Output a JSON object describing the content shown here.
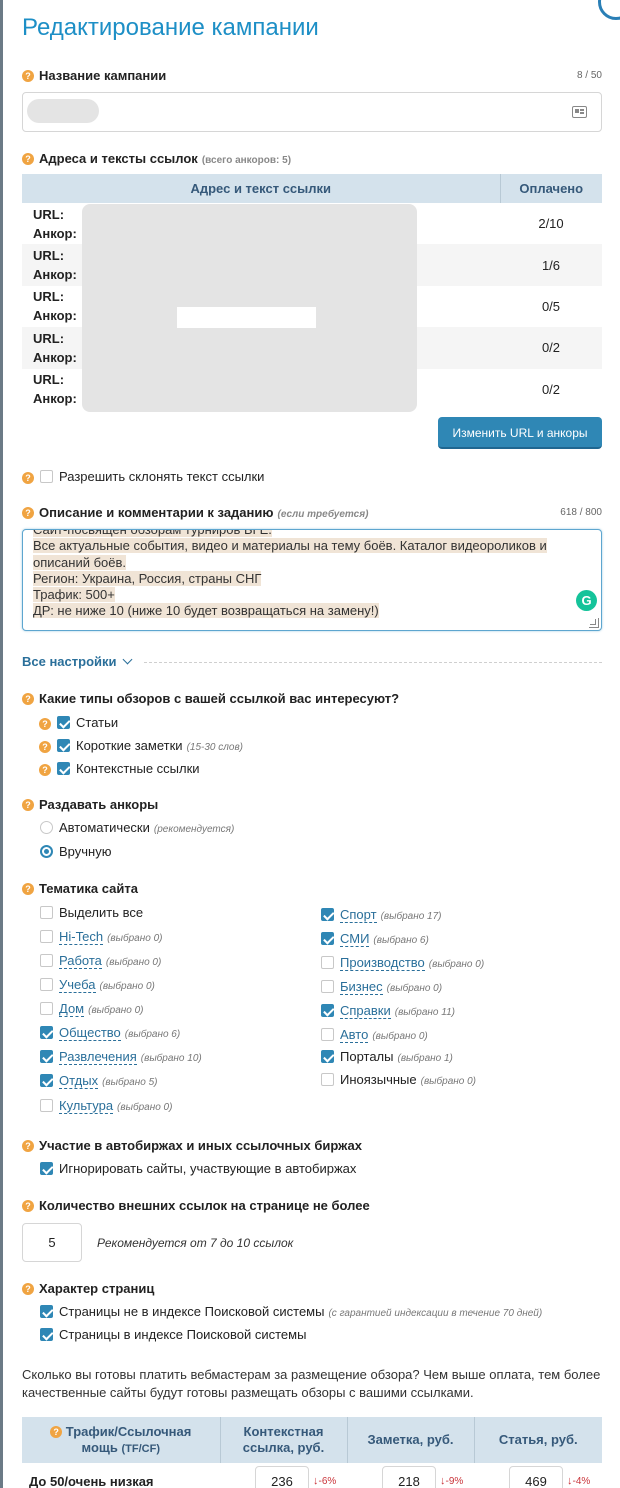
{
  "page": {
    "title": "Редактирование кампании"
  },
  "campaign_name": {
    "label": "Название кампании",
    "counter": "8 / 50",
    "value": ""
  },
  "links": {
    "label": "Адреса и тексты ссылок",
    "anchors_note": "(всего анкоров: 5)",
    "col_link": "Адрес и текст ссылки",
    "col_paid": "Оплачено",
    "url_label": "URL:",
    "anchor_label": "Анкор:",
    "rows": [
      {
        "url": "",
        "anchor": "",
        "paid": "2/10"
      },
      {
        "url": "",
        "anchor": "",
        "paid": "1/6"
      },
      {
        "url": "",
        "anchor": "",
        "paid": "0/5"
      },
      {
        "url": "",
        "anchor": "",
        "paid": "0/2"
      },
      {
        "url": "",
        "anchor": "",
        "paid": "0/2"
      }
    ],
    "edit_button": "Изменить URL и анкоры"
  },
  "inflect": {
    "label": "Разрешить склонять текст ссылки",
    "checked": false
  },
  "description": {
    "label": "Описание и комментарии к заданию",
    "note": "(если требуется)",
    "counter": "618 / 800",
    "lines": [
      "Сайт-посвящен обзорам турниров БГЕ.",
      "Все актуальные события, видео и материалы на тему боёв. Каталог видеороликов и",
      "описаний боёв.",
      " ",
      "Регион: Украина, Россия, страны СНГ",
      "Трафик: 500+",
      "ДР: не ниже 10 (ниже 10 будет возвращаться на замену!)"
    ]
  },
  "all_settings": "Все настройки",
  "review_types": {
    "label": "Какие типы обзоров с вашей ссылкой вас интересуют?",
    "items": [
      {
        "label": "Статьи",
        "hint": "",
        "checked": true
      },
      {
        "label": "Короткие заметки",
        "hint": "(15-30 слов)",
        "checked": true
      },
      {
        "label": "Контекстные ссылки",
        "hint": "",
        "checked": true
      }
    ]
  },
  "anchors_mode": {
    "label": "Раздавать анкоры",
    "options": [
      {
        "label": "Автоматически",
        "hint": "(рекомендуется)",
        "selected": false
      },
      {
        "label": "Вручную",
        "hint": "",
        "selected": true
      }
    ]
  },
  "topics": {
    "label": "Тематика сайта",
    "select_all": "Выделить все",
    "left": [
      {
        "label": "Hi-Tech",
        "count": "(выбрано 0)",
        "checked": false
      },
      {
        "label": "Работа",
        "count": "(выбрано 0)",
        "checked": false
      },
      {
        "label": "Учеба",
        "count": "(выбрано 0)",
        "checked": false
      },
      {
        "label": "Дом",
        "count": "(выбрано 0)",
        "checked": false
      },
      {
        "label": "Общество",
        "count": "(выбрано 6)",
        "checked": true
      },
      {
        "label": "Развлечения",
        "count": "(выбрано 10)",
        "checked": true
      },
      {
        "label": "Отдых",
        "count": "(выбрано 5)",
        "checked": true
      },
      {
        "label": "Культура",
        "count": "(выбрано 0)",
        "checked": false
      }
    ],
    "right": [
      {
        "label": "Спорт",
        "count": "(выбрано 17)",
        "checked": true
      },
      {
        "label": "СМИ",
        "count": "(выбрано 6)",
        "checked": true
      },
      {
        "label": "Производство",
        "count": "(выбрано 0)",
        "checked": false
      },
      {
        "label": "Бизнес",
        "count": "(выбрано 0)",
        "checked": false
      },
      {
        "label": "Справки",
        "count": "(выбрано 11)",
        "checked": true
      },
      {
        "label": "Авто",
        "count": "(выбрано 0)",
        "checked": false
      },
      {
        "label": "Порталы",
        "count": "(выбрано 1)",
        "checked": true
      },
      {
        "label": "Иноязычные",
        "count": "(выбрано 0)",
        "checked": false
      }
    ]
  },
  "exchanges": {
    "label": "Участие в автобиржах и иных ссылочных биржах",
    "option": "Игнорировать сайты, участвующие в автобиржах",
    "checked": true
  },
  "external_links": {
    "label": "Количество внешних ссылок на странице не более",
    "value": "5",
    "hint": "Рекомендуется от 7 до 10 ссылок"
  },
  "pages": {
    "label": "Характер страниц",
    "items": [
      {
        "label": "Страницы не в индексе Поисковой системы",
        "hint": "(с гарантией индексации в течение 70 дней)",
        "checked": true
      },
      {
        "label": "Страницы в индексе Поисковой системы",
        "hint": "",
        "checked": true
      }
    ]
  },
  "pricing": {
    "intro": "Сколько вы готовы платить вебмастерам за размещение обзора? Чем выше оплата, тем более качественные сайты будут готовы размещать обзоры с вашими ссылками.",
    "col_traffic_1": "Трафик/Ссылочная",
    "col_traffic_2": "мощь",
    "col_traffic_3": "(TF/CF)",
    "col_context_1": "Контекстная",
    "col_context_2": "ссылка, руб.",
    "col_note": "Заметка, руб.",
    "col_article": "Статья, руб.",
    "rows": [
      {
        "level": "До 50/очень низкая",
        "context": "236",
        "context_delta": "-6%",
        "note": "218",
        "note_delta": "-9%",
        "article": "469",
        "article_delta": "-4%"
      }
    ]
  },
  "colors": {
    "accent": "#1d8fc6",
    "button": "#2f87b5",
    "header_bg": "#d4e2ec",
    "hint_q": "#f0a442",
    "negative": "#c9343a"
  }
}
